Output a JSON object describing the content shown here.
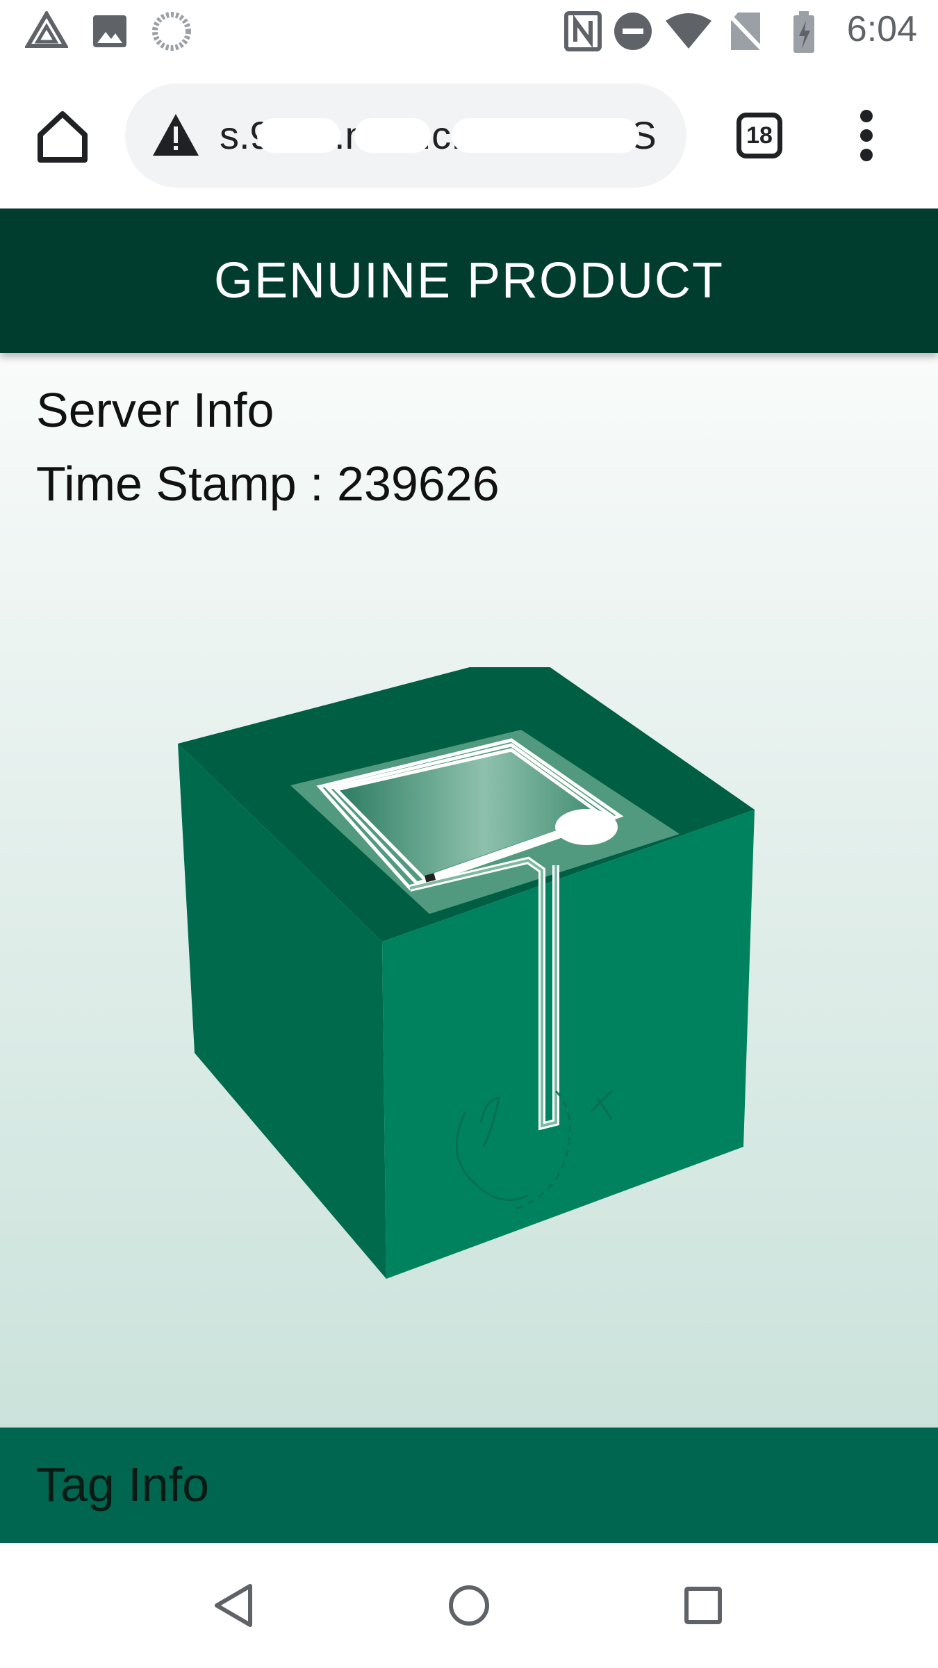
{
  "status_bar": {
    "time": "6:04",
    "left_icons": [
      "drive-icon",
      "image-icon",
      "sync-icon"
    ],
    "right_icons": [
      "nfc-icon",
      "do-not-disturb-icon",
      "wifi-icon",
      "no-sim-icon",
      "battery-charging-icon"
    ]
  },
  "browser": {
    "url_text": "s.9.ioo.n.e.r.c.oo.o.i.r.i.//SH.o9",
    "tab_count": "18",
    "home_icon": "home-icon",
    "warning_icon": "not-secure-warning-icon",
    "menu_icon": "more-vert-icon"
  },
  "page": {
    "banner_title": "GENUINE PRODUCT",
    "server_info_title": "Server Info",
    "timestamp_text": "Time Stamp : 239626",
    "tag_info_title": "Tag Info"
  },
  "nav_bar": {
    "icons": [
      "back-icon",
      "home-circle-icon",
      "recents-icon"
    ]
  },
  "colors": {
    "banner": "#003d2f",
    "tag_bar": "#006650",
    "box_front": "#00825f",
    "box_side": "#006b4c",
    "box_top": "#005e43"
  }
}
